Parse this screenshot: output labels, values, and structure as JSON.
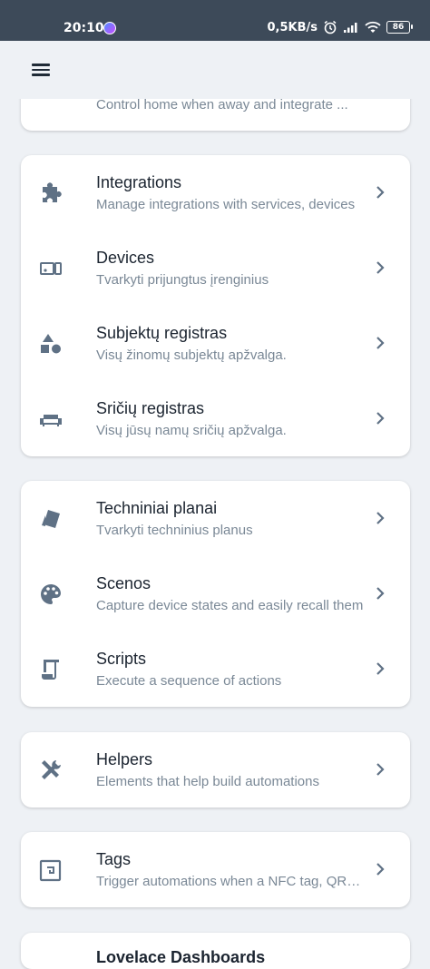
{
  "status": {
    "time": "20:10",
    "speed": "0,5KB/s",
    "battery": "86"
  },
  "cards": [
    {
      "items": [
        {
          "title": "",
          "desc": "Control home when away and integrate ...",
          "icon": "cloud-icon"
        }
      ]
    },
    {
      "items": [
        {
          "title": "Integrations",
          "desc": "Manage integrations with services, devices",
          "icon": "puzzle-icon"
        },
        {
          "title": "Devices",
          "desc": "Tvarkyti prijungtus įrenginius",
          "icon": "devices-icon"
        },
        {
          "title": "Subjektų registras",
          "desc": "Visų žinomų subjektų apžvalga.",
          "icon": "shapes-icon"
        },
        {
          "title": "Sričių registras",
          "desc": "Visų jūsų namų sričių apžvalga.",
          "icon": "sofa-icon"
        }
      ]
    },
    {
      "items": [
        {
          "title": "Techniniai planai",
          "desc": "Tvarkyti techninius planus",
          "icon": "blueprint-icon"
        },
        {
          "title": "Scenos",
          "desc": "Capture device states and easily recall them",
          "icon": "palette-icon"
        },
        {
          "title": "Scripts",
          "desc": "Execute a sequence of actions",
          "icon": "script-icon"
        }
      ]
    },
    {
      "items": [
        {
          "title": "Helpers",
          "desc": "Elements that help build automations",
          "icon": "tools-icon"
        }
      ]
    },
    {
      "items": [
        {
          "title": "Tags",
          "desc": "Trigger automations when a NFC tag, QR code",
          "icon": "nfc-tag-icon"
        }
      ]
    },
    {
      "items": [
        {
          "title": "Lovelace Dashboards",
          "desc": "",
          "icon": "dashboard-icon"
        }
      ]
    }
  ],
  "colors": {
    "icon": "#5f7185",
    "statusbar": "#3d4a59",
    "background": "#eef1f5"
  }
}
